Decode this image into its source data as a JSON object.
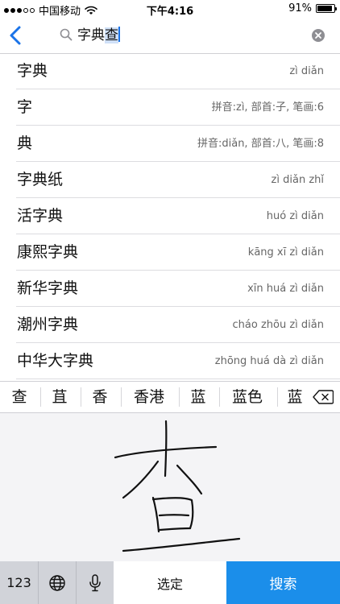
{
  "status_bar": {
    "carrier": "中国移动",
    "time": "下午4:16",
    "battery_text": "91%",
    "battery_level": 0.91,
    "wifi_icon": "wifi-icon",
    "battery_icon": "battery-icon"
  },
  "search": {
    "query_confirmed": "字典",
    "query_composing": "查",
    "back_icon": "chevron-left-icon",
    "search_icon": "magnifier-icon",
    "clear_icon": "clear-circle-icon"
  },
  "results": [
    {
      "word": "字典",
      "detail": "zì diǎn"
    },
    {
      "word": "字",
      "detail": "拼音:zì, 部首:子, 笔画:6"
    },
    {
      "word": "典",
      "detail": "拼音:diǎn, 部首:八, 笔画:8"
    },
    {
      "word": "字典纸",
      "detail": "zì diǎn zhǐ"
    },
    {
      "word": "活字典",
      "detail": "huó zì diǎn"
    },
    {
      "word": "康熙字典",
      "detail": "kāng xī zì diǎn"
    },
    {
      "word": "新华字典",
      "detail": "xīn huá zì diǎn"
    },
    {
      "word": "潮州字典",
      "detail": "cháo zhōu zì diǎn"
    },
    {
      "word": "中华大字典",
      "detail": "zhōng huá dà zì diǎn"
    }
  ],
  "keyboard": {
    "candidates": [
      "查",
      "苴",
      "香",
      "香港",
      "蓝",
      "蓝色",
      "蓝"
    ],
    "delete_icon": "backspace-icon",
    "handwriting_pad": "handwriting-canvas",
    "keys": {
      "numbers": "123",
      "globe_icon": "globe-icon",
      "mic_icon": "microphone-icon",
      "select": "选定",
      "search": "搜索"
    }
  },
  "colors": {
    "accent_blue": "#1b8eea",
    "back_blue": "#1a73e8",
    "selection_bg": "#cfe0f7"
  }
}
